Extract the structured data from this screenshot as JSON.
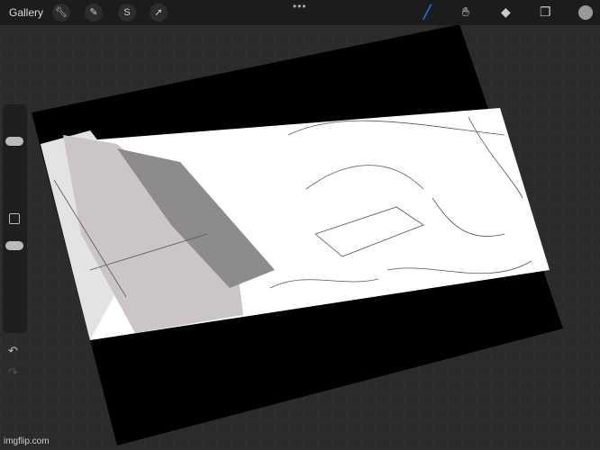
{
  "toolbar": {
    "gallery_label": "Gallery",
    "more_dots": "•••"
  },
  "watermark": "imgflip.com",
  "colors": {
    "brush_active": "#1f6fe6",
    "current_color": "#999999"
  }
}
